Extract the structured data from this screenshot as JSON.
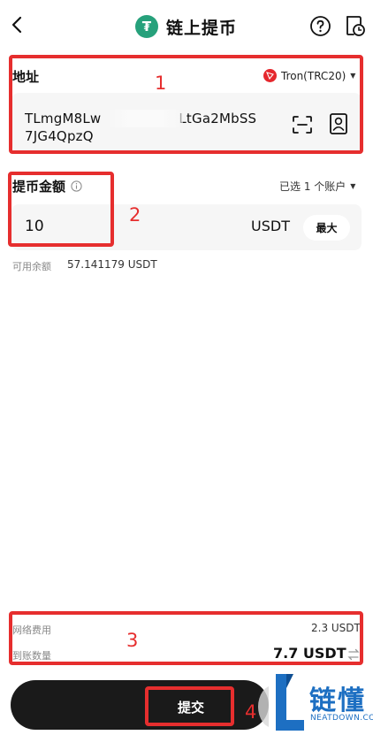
{
  "header": {
    "title": "链上提币",
    "coin_icon_glyph": "₮",
    "icons": [
      "back-arrow-icon",
      "help-icon",
      "history-icon"
    ]
  },
  "address": {
    "label": "地址",
    "network": "Tron(TRC20)",
    "line1_start": "TLmgM8Lw",
    "line1_end": "LtGa2MbSS",
    "line2": "7JG4QpzQ",
    "icons": [
      "scan-icon",
      "contact-book-icon"
    ]
  },
  "amount": {
    "label": "提币金额",
    "accounts": "已选 1 个账户",
    "value": "10",
    "unit": "USDT",
    "max_label": "最大",
    "available_label": "可用余额",
    "available_value": "57.141179 USDT"
  },
  "fee": {
    "network_fee_label": "网络费用",
    "network_fee_value": "2.3 USDT",
    "receive_label": "到账数量",
    "receive_value": "7.7 USDT"
  },
  "submit": {
    "label": "提交"
  },
  "annotations": {
    "n1": "1",
    "n2": "2",
    "n3": "3",
    "n4": "4",
    "color": "#e62e2e"
  },
  "watermark": {
    "title": "链懂",
    "subtitle": "NEATDOWN.COM",
    "color": "#1d6fc2"
  },
  "colors": {
    "tether_green": "#26a17b",
    "tron_red": "#e5272d",
    "field_bg": "#f6f6f6",
    "button_dark": "#1a1a1a"
  }
}
